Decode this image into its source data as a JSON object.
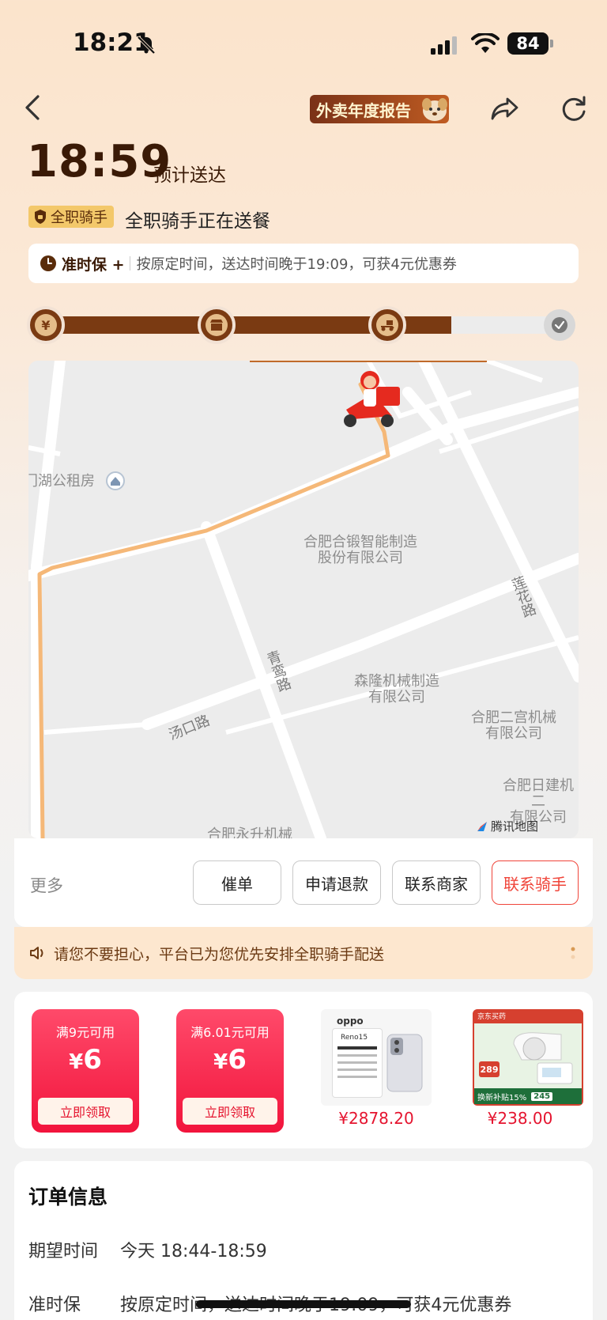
{
  "status_bar": {
    "time": "18:21",
    "battery": "84"
  },
  "nav": {
    "banner_text": "外卖年度报告"
  },
  "delivery": {
    "eta": "18:59",
    "eta_label": "预计送达",
    "rider_badge": "全职骑手",
    "rider_status": "全职骑手正在送餐"
  },
  "ontime_bar": {
    "brand": "准时保",
    "plus": "+",
    "text": "按原定时间，送达时间晚于19:09，可获4元优惠券"
  },
  "progress": {
    "steps": [
      "¥",
      "store",
      "rider",
      "done"
    ],
    "fraction": 0.78
  },
  "map": {
    "places": [
      {
        "name": "门湖公租房"
      },
      {
        "name": "合肥合锻智能制造\n股份有限公司"
      },
      {
        "name": "森隆机械制造\n有限公司"
      },
      {
        "name": "合肥二宫机械\n有限公司"
      },
      {
        "name": "合肥日建机二\n有限公司"
      },
      {
        "name": "合肥永升机械"
      }
    ],
    "roads": [
      "莲花路",
      "青鸾路",
      "汤口路"
    ],
    "provider": "腾讯地图"
  },
  "actions": {
    "more": "更多",
    "urge": "催单",
    "refund": "申请退款",
    "contact_merchant": "联系商家",
    "contact_rider": "联系骑手"
  },
  "notice": {
    "text": "请您不要担心，平台已为您优先安排全职骑手配送"
  },
  "promotions": {
    "coupons": [
      {
        "condition": "满9元可用",
        "currency": "¥",
        "amount": "6",
        "action": "立即领取"
      },
      {
        "condition": "满6.01元可用",
        "currency": "¥",
        "amount": "6",
        "action": "立即领取"
      }
    ],
    "products": [
      {
        "brand": "oppo",
        "model": "Reno15",
        "price": "¥2878.20"
      },
      {
        "brand": "京东买药",
        "badge": "289",
        "sub": "换新补贴15%",
        "sub_price": "245",
        "price": "¥238.00"
      }
    ]
  },
  "order_info": {
    "title": "订单信息",
    "rows": [
      {
        "label": "期望时间",
        "value": "今天 18:44-18:59"
      },
      {
        "label": "准时保",
        "value": "按原定时间，送达时间晚于19:09，可获4元优惠券"
      }
    ]
  },
  "colors": {
    "brand_brown": "#7a3a12",
    "accent_red": "#f0453a",
    "route": "#f5b878"
  }
}
